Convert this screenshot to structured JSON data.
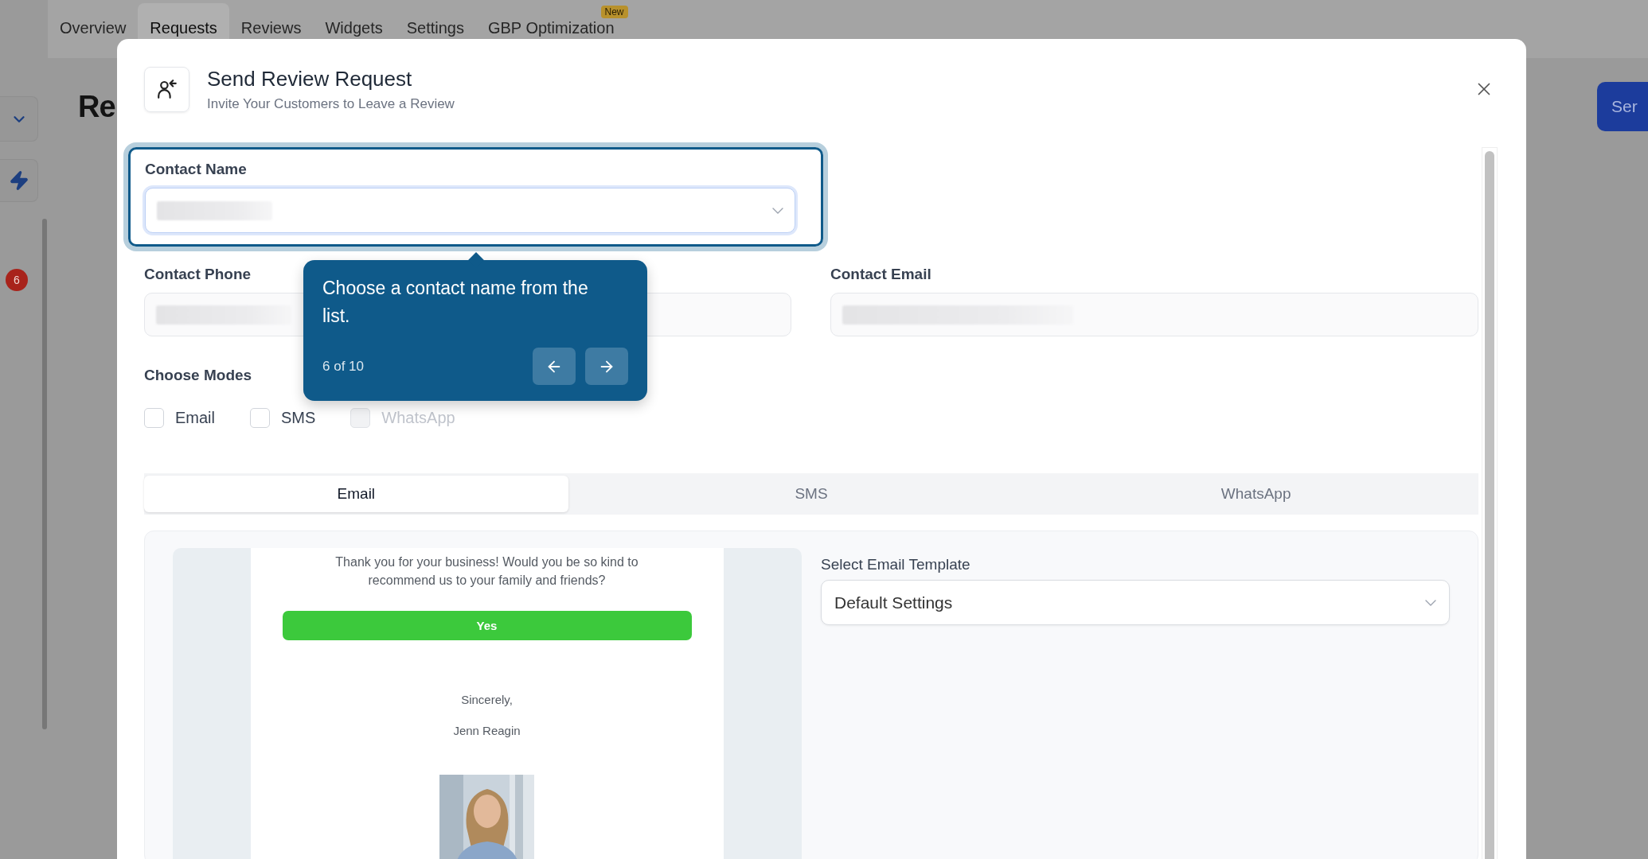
{
  "background_page": {
    "tabs": [
      {
        "label": "Overview",
        "selected": false
      },
      {
        "label": "Requests",
        "selected": true
      },
      {
        "label": "Reviews",
        "selected": false
      },
      {
        "label": "Widgets",
        "selected": false
      },
      {
        "label": "Settings",
        "selected": false
      },
      {
        "label": "GBP Optimization",
        "selected": false,
        "badge": "New"
      }
    ],
    "heading": "Re",
    "action_button": "Ser",
    "notification_count": "6"
  },
  "modal": {
    "title": "Send Review Request",
    "subtitle": "Invite Your Customers to Leave a Review",
    "fields": [
      {
        "label": "Contact Name",
        "kind": "select",
        "highlighted": true,
        "value_hidden": true
      },
      {
        "label": "Contact Phone",
        "kind": "input",
        "highlighted": false,
        "value_hidden": true
      },
      {
        "label": "Contact Email",
        "kind": "input",
        "highlighted": false,
        "value_hidden": true
      }
    ],
    "modes": {
      "label": "Choose Modes",
      "options": [
        {
          "label": "Email",
          "checked": false,
          "disabled": false
        },
        {
          "label": "SMS",
          "checked": false,
          "disabled": false
        },
        {
          "label": "WhatsApp",
          "checked": false,
          "disabled": true
        }
      ]
    },
    "channel_tabs": [
      {
        "label": "Email",
        "selected": true
      },
      {
        "label": "SMS",
        "selected": false
      },
      {
        "label": "WhatsApp",
        "selected": false
      }
    ],
    "email_preview": {
      "message": "Thank you for your business! Would you be so kind to recommend us to your family and friends?",
      "button": "Yes",
      "closing": "Sincerely,",
      "signature": "Jenn Reagin"
    },
    "template": {
      "label": "Select Email Template",
      "value": "Default Settings"
    }
  },
  "tour_tooltip": {
    "text": "Choose a contact name from the list.",
    "step": "6 of 10"
  }
}
